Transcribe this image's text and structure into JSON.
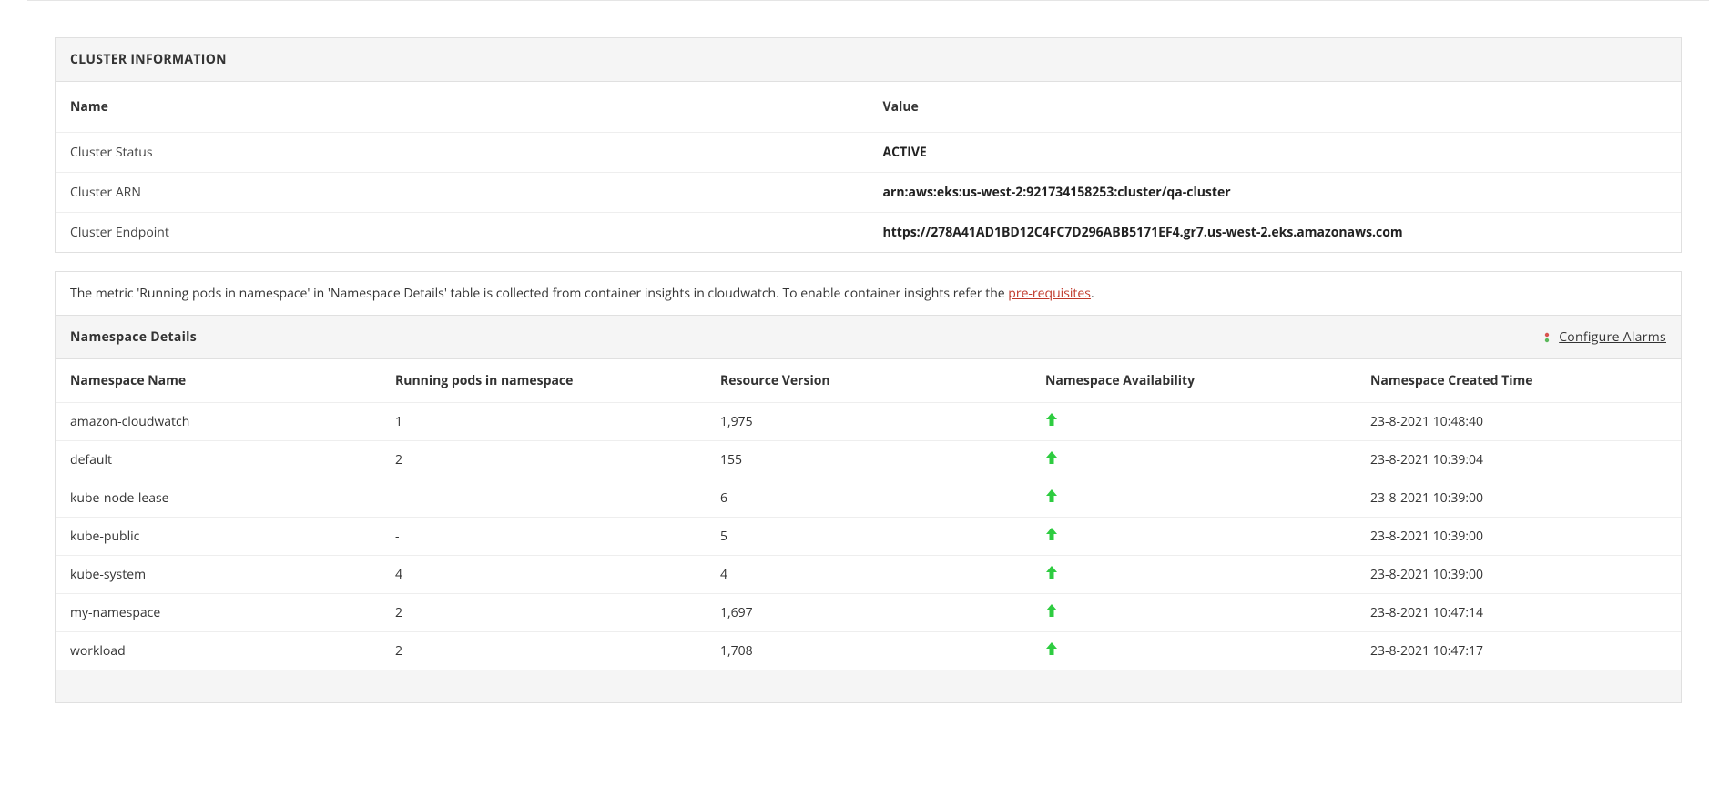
{
  "cluster_info": {
    "title": "CLUSTER INFORMATION",
    "headers": {
      "name": "Name",
      "value": "Value"
    },
    "rows": [
      {
        "name": "Cluster Status",
        "value": "ACTIVE"
      },
      {
        "name": "Cluster ARN",
        "value": "arn:aws:eks:us-west-2:921734158253:cluster/qa-cluster"
      },
      {
        "name": "Cluster Endpoint",
        "value": "https://278A41AD1BD12C4FC7D296ABB5171EF4.gr7.us-west-2.eks.amazonaws.com"
      }
    ]
  },
  "notice": {
    "text_prefix": "The metric 'Running pods in namespace' in 'Namespace Details' table is collected from container insights in cloudwatch. To enable container insights refer the ",
    "link_label": "pre-requisites",
    "text_suffix": "."
  },
  "namespace_panel": {
    "title": "Namespace Details",
    "configure_label": "Configure Alarms",
    "columns": {
      "name": "Namespace Name",
      "pods": "Running pods in namespace",
      "res": "Resource Version",
      "avail": "Namespace Availability",
      "time": "Namespace Created Time"
    },
    "rows": [
      {
        "name": "amazon-cloudwatch",
        "pods": "1",
        "res": "1,975",
        "avail": "up",
        "time": "23-8-2021 10:48:40"
      },
      {
        "name": "default",
        "pods": "2",
        "res": "155",
        "avail": "up",
        "time": "23-8-2021 10:39:04"
      },
      {
        "name": "kube-node-lease",
        "pods": "-",
        "res": "6",
        "avail": "up",
        "time": "23-8-2021 10:39:00"
      },
      {
        "name": "kube-public",
        "pods": "-",
        "res": "5",
        "avail": "up",
        "time": "23-8-2021 10:39:00"
      },
      {
        "name": "kube-system",
        "pods": "4",
        "res": "4",
        "avail": "up",
        "time": "23-8-2021 10:39:00"
      },
      {
        "name": "my-namespace",
        "pods": "2",
        "res": "1,697",
        "avail": "up",
        "time": "23-8-2021 10:47:14"
      },
      {
        "name": "workload",
        "pods": "2",
        "res": "1,708",
        "avail": "up",
        "time": "23-8-2021 10:47:17"
      }
    ]
  }
}
